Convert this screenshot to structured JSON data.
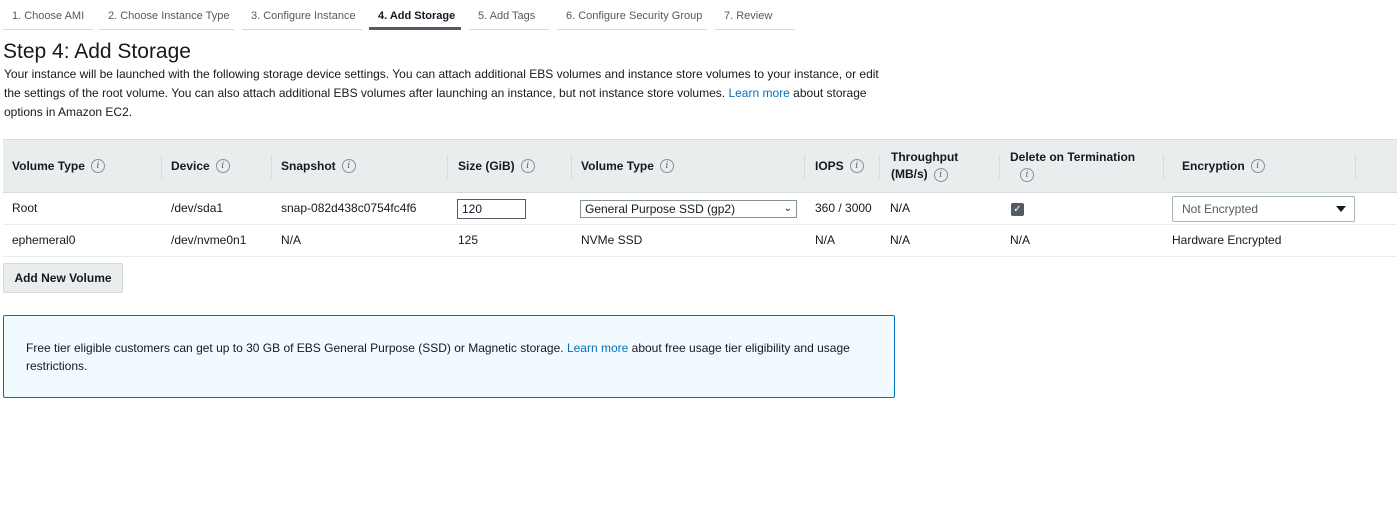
{
  "wizard": {
    "tabs": [
      {
        "label": "1. Choose AMI"
      },
      {
        "label": "2. Choose Instance Type"
      },
      {
        "label": "3. Configure Instance"
      },
      {
        "label": "4. Add Storage"
      },
      {
        "label": "5. Add Tags"
      },
      {
        "label": "6. Configure Security Group"
      },
      {
        "label": "7. Review"
      }
    ],
    "active_tab": "4. Add Storage"
  },
  "page": {
    "title": "Step 4: Add Storage",
    "description_text": "Your instance will be launched with the following storage device settings. You can attach additional EBS volumes and instance store volumes to your instance, or edit the settings of the root volume. You can also attach additional EBS volumes after launching an instance, but not instance store volumes.",
    "description_link": "Learn more",
    "description_suffix": "about storage options in Amazon EC2."
  },
  "table": {
    "headers": {
      "volume_type": "Volume Type",
      "device": "Device",
      "snapshot": "Snapshot",
      "size": "Size (GiB)",
      "volume_type2": "Volume Type",
      "iops": "IOPS",
      "throughput_line1": "Throughput",
      "throughput_line2": "(MB/s)",
      "delete_on_termination": "Delete on Termination",
      "encryption": "Encryption"
    },
    "rows": [
      {
        "volume_type": "Root",
        "device": "/dev/sda1",
        "snapshot": "snap-082d438c0754fc4f6",
        "size": "120",
        "volume_type2": "General Purpose SSD (gp2)",
        "iops": "360 / 3000",
        "throughput": "N/A",
        "delete_on_termination": true,
        "encryption": "Not Encrypted"
      },
      {
        "volume_type": "ephemeral0",
        "device": "/dev/nvme0n1",
        "snapshot": "N/A",
        "size": "125",
        "volume_type2": "NVMe SSD",
        "iops": "N/A",
        "throughput": "N/A",
        "delete_on_termination": "N/A",
        "encryption": "Hardware Encrypted"
      }
    ]
  },
  "actions": {
    "add_volume": "Add New Volume"
  },
  "alert": {
    "text": "Free tier eligible customers can get up to 30 GB of EBS General Purpose (SSD) or Magnetic storage.",
    "link": "Learn more",
    "suffix": "about free usage tier eligibility and usage restrictions."
  },
  "icons": {
    "info": "info-icon",
    "chevron": "chevron-down-icon",
    "caret": "caret-down-icon",
    "check": "checkmark-icon"
  },
  "colors": {
    "link": "#0073bb",
    "header_bg": "#eaeded",
    "alert_bg": "#f1faff",
    "alert_border": "#0073bb"
  }
}
